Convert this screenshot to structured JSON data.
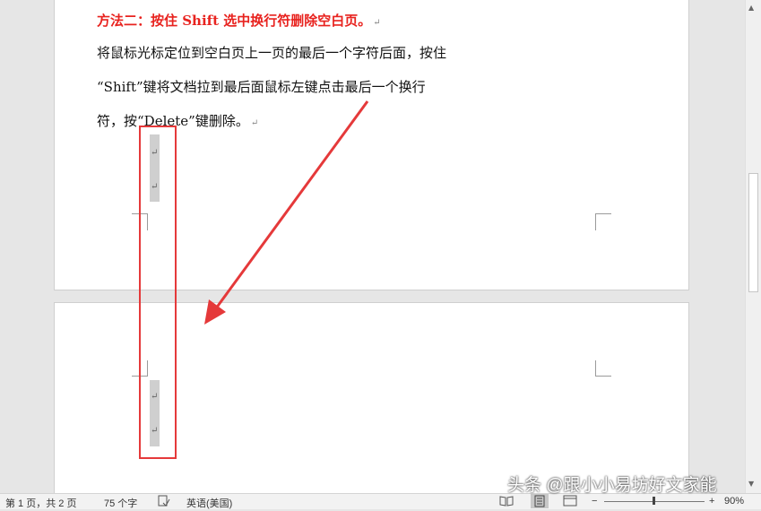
{
  "document": {
    "heading": "方法二：按住 Shift 选中换行符删除空白页。",
    "line1": "将鼠标光标定位到空白页上一页的最后一个字符后面，按住",
    "line2": "“Shift”键将文档拉到最后面鼠标左键点击最后一个换行",
    "line3": "符，按“Delete”键删除。",
    "paragraph_mark": "↵"
  },
  "status_bar": {
    "page_info": "第 1 页，共 2 页",
    "word_count": "75 个字",
    "language": "英语(美国)",
    "zoom_minus": "−",
    "zoom_plus": "+",
    "zoom_level": "90%"
  },
  "watermark": "头条 @跟小小易坊好文家能",
  "colors": {
    "heading": "#e8231f",
    "annotation": "#e5393a"
  }
}
